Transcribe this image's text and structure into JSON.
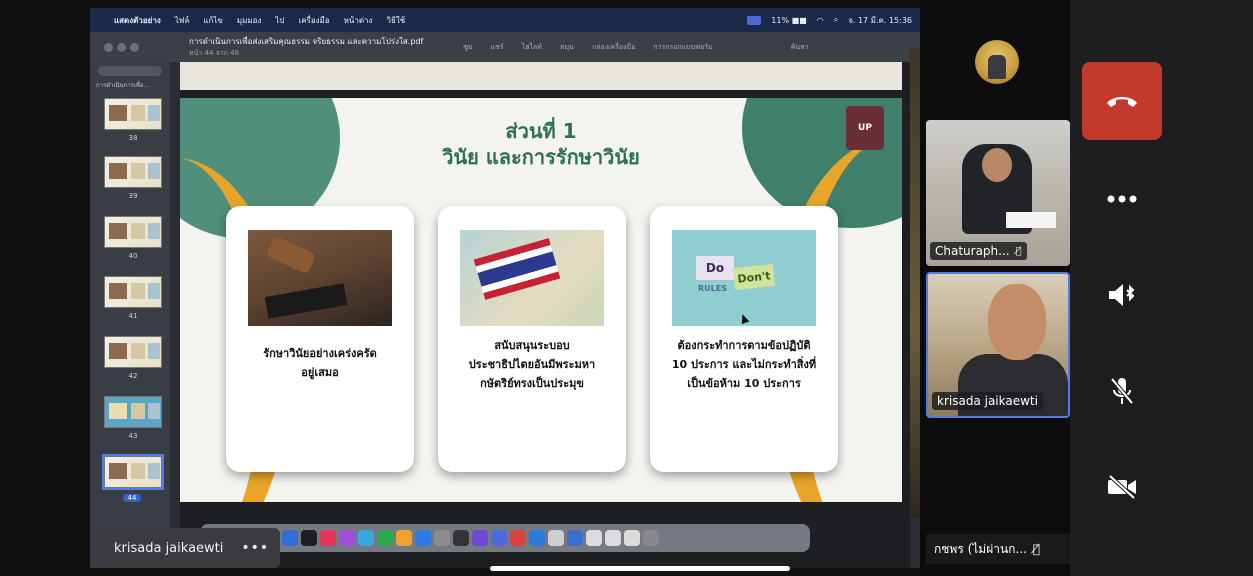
{
  "shared_screen": {
    "mac_menubar": {
      "app_name": "แสดงตัวอย่าง",
      "menus": [
        "ไฟล์",
        "แก้ไข",
        "มุมมอง",
        "ไป",
        "เครื่องมือ",
        "หน้าต่าง",
        "วิธีใช้"
      ],
      "clock": "จ. 17 มี.ค. 15:36",
      "battery": "11% ■■"
    },
    "pdf_toolbar": {
      "document_title": "การดำเนินการเพื่อส่งเสริมคุณธรรม จริยธรรม และความโปร่งใส.pdf",
      "page_indicator": "หน้า 44 จาก 48",
      "tools": [
        "ซูม",
        "แชร์",
        "ไฮไลท์",
        "หมุน",
        "กล่องเครื่องมือ",
        "การกรอกแบบฟอร์ม",
        "ค้นหา"
      ]
    },
    "sidebar": {
      "section_label": "การดำเนินการเพื่อ...",
      "thumbnails": [
        {
          "page": "38"
        },
        {
          "page": "39"
        },
        {
          "page": "40"
        },
        {
          "page": "41"
        },
        {
          "page": "42"
        },
        {
          "page": "43"
        },
        {
          "page": "44",
          "active": true
        }
      ]
    },
    "slide": {
      "title_line1": "ส่วนที่ 1",
      "title_line2": "วินัย และการรักษาวินัย",
      "logo_text": "UP",
      "cards": [
        {
          "image": "gavel-image",
          "text": "รักษาวินัยอย่างเคร่งครัดอยู่เสมอ"
        },
        {
          "image": "thai-flag-map-image",
          "text": "สนับสนุนระบอบประชาธิปไตยอันมีพระมหากษัตริย์ทรงเป็นประมุข"
        },
        {
          "image": "do-dont-rules-image",
          "text": "ต้องกระทำการตามข้อปฏิบัติ 10 ประการ และไม่กระทำสิ่งที่เป็นข้อห้าม 10 ประการ"
        }
      ],
      "rules_image": {
        "do": "Do",
        "dont": "Don't",
        "rules": "RULES"
      }
    },
    "presenter_chip": {
      "name": "krisada jaikaewti",
      "more": "•••"
    }
  },
  "participants": {
    "tile1_name": "Chaturaph...",
    "tile2_name": "krisada jaikaewti",
    "bottom_tile_name": "กชพร (ไม่ผ่านก..."
  },
  "controls": {
    "leave_color": "#c4392e",
    "items": [
      "phone-hangup-icon",
      "more-icon",
      "speaker-icon",
      "mic-off-icon",
      "camera-off-icon"
    ]
  }
}
